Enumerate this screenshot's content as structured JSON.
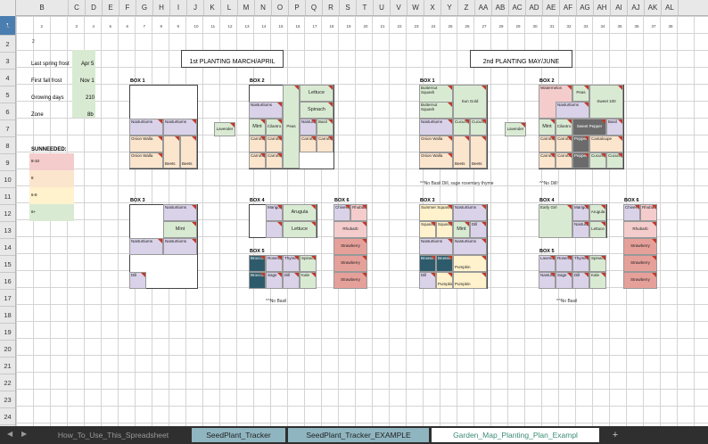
{
  "columns": [
    "A",
    "B",
    "C",
    "D",
    "E",
    "F",
    "G",
    "H",
    "I",
    "J",
    "K",
    "L",
    "M",
    "N",
    "O",
    "P",
    "Q",
    "R",
    "S",
    "T",
    "U",
    "V",
    "W",
    "X",
    "Y",
    "Z",
    "AA",
    "AB",
    "AC",
    "AD",
    "AE",
    "AF",
    "AG",
    "AH",
    "AI",
    "AJ",
    "AK",
    "AL"
  ],
  "rows": [
    "1",
    "2",
    "3",
    "4",
    "5",
    "6",
    "7",
    "8",
    "9",
    "10",
    "11",
    "12",
    "13",
    "14",
    "15",
    "16",
    "17",
    "18",
    "19",
    "20",
    "21",
    "22",
    "23",
    "24",
    "25",
    "26"
  ],
  "row1_numbers": [
    "1",
    "2",
    "3",
    "4",
    "5",
    "6",
    "7",
    "8",
    "9",
    "10",
    "11",
    "12",
    "13",
    "14",
    "15",
    "16",
    "17",
    "18",
    "19",
    "20",
    "21",
    "22",
    "23",
    "24",
    "25",
    "26",
    "27",
    "28",
    "29",
    "30",
    "31",
    "32",
    "33",
    "34",
    "35",
    "36",
    "37",
    "38"
  ],
  "info": {
    "row2": "2",
    "last_frost_label": "Last spring frost",
    "last_frost_value": "Apr 5",
    "first_frost_label": "First fall frost",
    "first_frost_value": "Nov 1",
    "growing_days_label": "Growing days",
    "growing_days_value": "210",
    "zone_label": "Zone",
    "zone_value": "8b",
    "sun_title": "SUNNEEDED:",
    "sun_levels": [
      "8-10",
      "8",
      "6-8",
      "6+"
    ],
    "sun_colors": [
      "#f4cccc",
      "#fce5cd",
      "#fff2cc",
      "#d9ead3"
    ]
  },
  "planting1": {
    "title": "1st PLANTING MARCH/APRIL",
    "box1": "BOX 1",
    "box2": "BOX 2",
    "box3": "BOX 3",
    "box4": "BOX 4",
    "box5": "BOX 5",
    "box6": "BOX 6",
    "lavender": "Lavender",
    "no_basil": "^^No Basil"
  },
  "planting2": {
    "title": "2nd PLANTING MAY/JUNE",
    "box1": "BOX 1",
    "box2": "BOX 2",
    "box3": "BOX 3",
    "box4": "BOX 4",
    "box5": "BOX 5",
    "box6": "BOX 6",
    "lavender": "Lavender",
    "note_box1": "^^No Basil Dill, sage rosemary thyme",
    "note_box2": "^^No Dill!",
    "no_basil": "^^No Basil"
  },
  "plants": {
    "nasturtiums": "Nasturtiums",
    "onion_walla": "Onion Walla",
    "beets": "Beets",
    "lettuce": "Lettuce",
    "spinach": "Spinach",
    "peas": "Peas",
    "mint": "Mint",
    "cilantro": "Cilantro",
    "basil": "Basil",
    "carrots": "Carrots",
    "dill": "Dill",
    "marigold": "Marigold",
    "arugula": "Arugula",
    "chives": "Chives",
    "rhubarb": "Rhubarb",
    "strawberry": "Strawberry",
    "broccoli": "Broccoli",
    "rosemary": "Rosemary",
    "thyme": "Thyme",
    "sage": "Sage",
    "butternut": "Butternut Squash",
    "sun_gold": "Sun Gold",
    "cucumber": "Cucumber",
    "watermelon": "Watermelon",
    "sweet100": "Sweet 100",
    "sweet_pepper": "Sweet Pepper",
    "pepper": "Pepper",
    "cantaloupe": "Cantaloupe",
    "summer_squash": "Summer Squash",
    "squash": "Squash",
    "brussels": "Brussels",
    "pumpkin": "Pumpkin",
    "early_girl": "Early Girl"
  },
  "tabs": {
    "t1": "How_To_Use_This_Spreadsheet",
    "t2": "SeedPlant_Tracker",
    "t3": "SeedPlant_Tracker_EXAMPLE",
    "t4": "Garden_Map_Planting_Plan_Exampl",
    "add": "+"
  },
  "colors": {
    "purple": "#d9d2e9",
    "green": "#d9ead3",
    "orange": "#fce5cd",
    "pink": "#f4cccc",
    "yellow": "#fff2cc",
    "red": "#e6a09a",
    "teal": "#2e5b6b",
    "gray": "#6b6b6b"
  }
}
